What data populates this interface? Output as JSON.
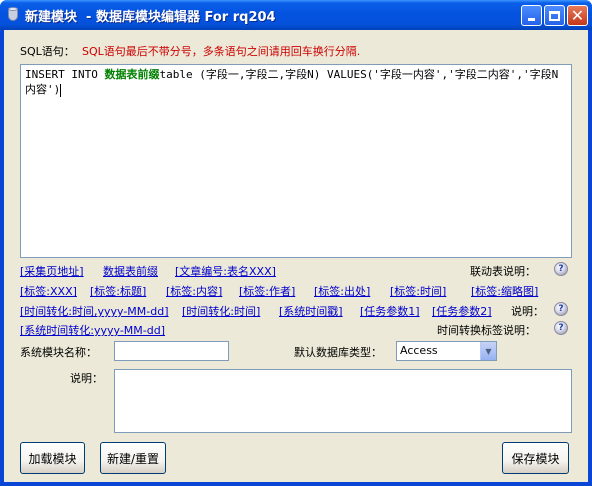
{
  "window": {
    "title": "新建模块  - 数据库模块编辑器 For rq204"
  },
  "sql": {
    "label": "SQL语句：",
    "hint": "SQL语句最后不带分号，多条语句之间请用回车换行分隔.",
    "editor_line1_before": "INSERT INTO ",
    "editor_highlight": "数据表前缀",
    "editor_line1_after": "table (字段一,字段二,字段N) VALUES('字段一内容','字段二内容','字段N",
    "editor_line2": "内容')"
  },
  "tags": {
    "row1": [
      "[采集页地址]",
      "数据表前缀",
      "[文章编号:表名XXX]"
    ],
    "row2": [
      "[标签:XXX]",
      "[标签:标题]",
      "[标签:内容]",
      "[标签:作者]",
      "[标签:出处]",
      "[标签:时间]",
      "[标签:缩略图]"
    ],
    "row3": [
      "[时间转化:时间,yyyy-MM-dd]",
      "[时间转化:时间]",
      "[系统时间戳]",
      "[任务参数1]",
      "[任务参数2]"
    ],
    "row4": [
      "[系统时间转化:yyyy-MM-dd]"
    ],
    "linked_table_help": "联动表说明：",
    "tags_help": "说明：",
    "time_help": "时间转换标签说明："
  },
  "form": {
    "module_name_label": "系统模块名称：",
    "module_name_value": "",
    "db_type_label": "默认数据库类型：",
    "db_type_value": "Access",
    "desc_label": "说明：",
    "desc_value": ""
  },
  "buttons": {
    "load": "加载模块",
    "new_reset": "新建/重置",
    "save": "保存模块"
  }
}
